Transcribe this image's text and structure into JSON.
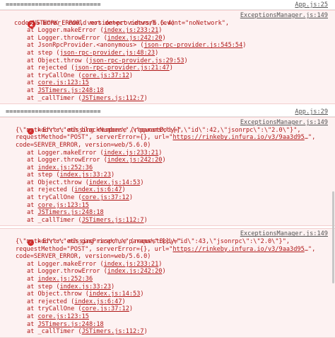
{
  "separator_text": "==========================",
  "block1": {
    "source": "App.js:25",
    "badge_count": "2",
    "title": "Error: could not detect network (event=\"noNetwork\",",
    "source_right": "ExceptionsManager.js:149",
    "title_cont": "code=NETWORK_ERROR, version=providers/5.6.4)",
    "stack": [
      {
        "pre": "at Logger.makeError (",
        "link": "index.js:233:21",
        "post": ")"
      },
      {
        "pre": "at Logger.throwError (",
        "link": "index.js:242:20",
        "post": ")"
      },
      {
        "pre": "at JsonRpcProvider.<anonymous> (",
        "link": "json-rpc-provider.js:545:54",
        "post": ")"
      },
      {
        "pre": "at step (",
        "link": "json-rpc-provider.js:48:23",
        "post": ")"
      },
      {
        "pre": "at Object.throw (",
        "link": "json-rpc-provider.js:29:53",
        "post": ")"
      },
      {
        "pre": "at rejected (",
        "link": "json-rpc-provider.js:21:47",
        "post": ")"
      },
      {
        "pre": "at tryCallOne (",
        "link": "core.js:37:12",
        "post": ")"
      },
      {
        "pre": "at ",
        "link": "core.js:123:15",
        "post": ""
      },
      {
        "pre": "at ",
        "link": "JSTimers.js:248:18",
        "post": ""
      },
      {
        "pre": "at _callTimer (",
        "link": "JSTimers.js:112:7",
        "post": ")"
      }
    ]
  },
  "block2": {
    "source": "App.js:29",
    "title": "Error: missing response (requestBody=\"",
    "source_right": "ExceptionsManager.js:149",
    "body_line": "{\\\"method\\\":\\\"eth_blockNumber\\\",\\\"params\\\":[],\\\"id\\\":42,\\\"jsonrpc\\\":\\\"2.0\\\"}\",",
    "method_pre": "requestMethod=\"POST\", serverError={}, url=\"",
    "method_link": "https://rinkeby.infura.io/v3/9aa3d95",
    "method_post": "…\",",
    "code_line": "code=SERVER_ERROR, version=web/5.6.0)",
    "stack": [
      {
        "pre": "at Logger.makeError (",
        "link": "index.js:233:21",
        "post": ")"
      },
      {
        "pre": "at Logger.throwError (",
        "link": "index.js:242:20",
        "post": ")"
      },
      {
        "pre": "at ",
        "link": "index.js:252:36",
        "post": ""
      },
      {
        "pre": "at step (",
        "link": "index.js:33:23",
        "post": ")"
      },
      {
        "pre": "at Object.throw (",
        "link": "index.js:14:53",
        "post": ")"
      },
      {
        "pre": "at rejected (",
        "link": "index.js:6:47",
        "post": ")"
      },
      {
        "pre": "at tryCallOne (",
        "link": "core.js:37:12",
        "post": ")"
      },
      {
        "pre": "at ",
        "link": "core.js:123:15",
        "post": ""
      },
      {
        "pre": "at ",
        "link": "JSTimers.js:248:18",
        "post": ""
      },
      {
        "pre": "at _callTimer (",
        "link": "JSTimers.js:112:7",
        "post": ")"
      }
    ]
  },
  "block3": {
    "title": "Error: missing response (requestBody=\"",
    "source_right": "ExceptionsManager.js:149",
    "body_line": "{\\\"method\\\":\\\"eth_gasPrice\\\",\\\"params\\\":[],\\\"id\\\":43,\\\"jsonrpc\\\":\\\"2.0\\\"}\",",
    "method_pre": "requestMethod=\"POST\", serverError={}, url=\"",
    "method_link": "https://rinkeby.infura.io/v3/9aa3d95",
    "method_post": "…\",",
    "code_line": "code=SERVER_ERROR, version=web/5.6.0)",
    "stack": [
      {
        "pre": "at Logger.makeError (",
        "link": "index.js:233:21",
        "post": ")"
      },
      {
        "pre": "at Logger.throwError (",
        "link": "index.js:242:20",
        "post": ")"
      },
      {
        "pre": "at ",
        "link": "index.js:252:36",
        "post": ""
      },
      {
        "pre": "at step (",
        "link": "index.js:33:23",
        "post": ")"
      },
      {
        "pre": "at Object.throw (",
        "link": "index.js:14:53",
        "post": ")"
      },
      {
        "pre": "at rejected (",
        "link": "index.js:6:47",
        "post": ")"
      },
      {
        "pre": "at tryCallOne (",
        "link": "core.js:37:12",
        "post": ")"
      },
      {
        "pre": "at ",
        "link": "core.js:123:15",
        "post": ""
      },
      {
        "pre": "at ",
        "link": "JSTimers.js:248:18",
        "post": ""
      },
      {
        "pre": "at _callTimer (",
        "link": "JSTimers.js:112:7",
        "post": ")"
      }
    ]
  },
  "icons": {
    "badge": "error-count-badge",
    "error": "error-x-icon",
    "expand": "expand-triangle-icon"
  },
  "colors": {
    "error_text": "#b01818",
    "error_bg": "#fdf2f2",
    "badge_red": "#d52a2a"
  }
}
